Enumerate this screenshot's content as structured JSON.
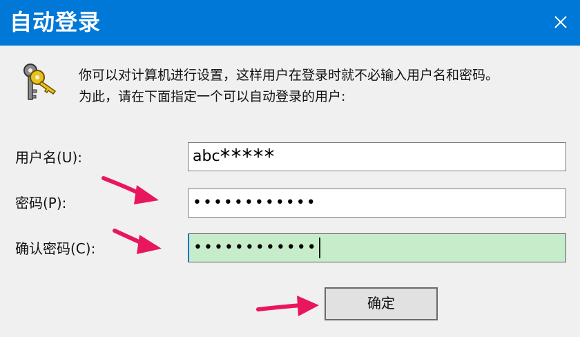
{
  "window": {
    "title": "自动登录",
    "close_icon": "close-icon"
  },
  "message": {
    "line1": "你可以对计算机进行设置，这样用户在登录时就不必输入用户名和密码。",
    "line2": "为此，请在下面指定一个可以自动登录的用户:"
  },
  "form": {
    "username_label": "用户名(U):",
    "username_value": "abc",
    "username_masked": "*****",
    "password_label": "密码(P):",
    "password_value": "••••••••••••",
    "confirm_label": "确认密码(C):",
    "confirm_value": "••••••••••••"
  },
  "buttons": {
    "ok_label": "确定"
  },
  "colors": {
    "titlebar": "#0078d7",
    "confirm_field_bg": "#c7ecc9",
    "annotation_arrow": "#e8175d"
  },
  "icons": [
    "keys-icon",
    "close-icon",
    "pointer-arrow-icon"
  ]
}
